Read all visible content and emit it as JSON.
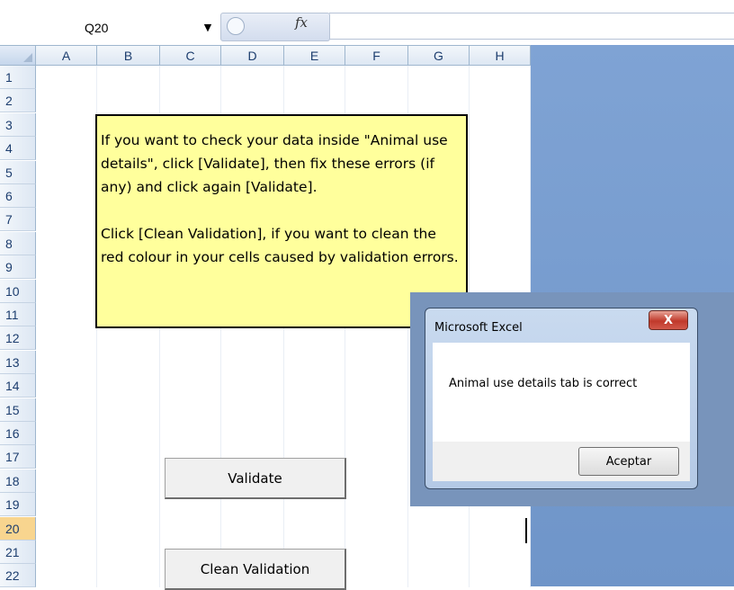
{
  "formula_bar": {
    "name_box": "Q20",
    "fx_label": "fx",
    "formula": ""
  },
  "columns": [
    "A",
    "B",
    "C",
    "D",
    "E",
    "F",
    "G",
    "H"
  ],
  "rows": [
    "1",
    "2",
    "3",
    "4",
    "5",
    "6",
    "7",
    "8",
    "9",
    "10",
    "11",
    "12",
    "13",
    "14",
    "15",
    "16",
    "17",
    "18",
    "19",
    "20",
    "21",
    "22"
  ],
  "selected_row": "20",
  "note": {
    "paragraph1": "If you want to check your data inside \"Animal use details\", click [Validate], then fix these errors (if any) and click again [Validate].",
    "paragraph2": "Click [Clean Validation], if you want to clean the red colour in your cells caused by validation errors."
  },
  "buttons": {
    "validate": "Validate",
    "clean_validation": "Clean Validation"
  },
  "dialog": {
    "title": "Microsoft Excel",
    "close": "X",
    "message": "Animal use details tab is correct",
    "ok_label": "Aceptar"
  },
  "colors": {
    "note_fill": "#ffff9c",
    "workspace_blue": "#7fa3d4",
    "selected_row_header": "#f8d58f"
  }
}
